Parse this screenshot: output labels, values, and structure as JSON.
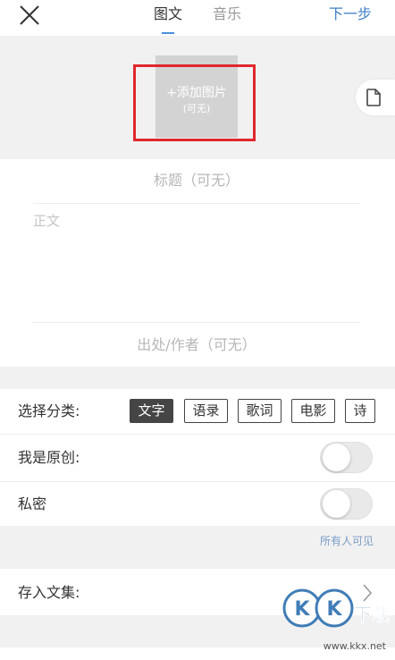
{
  "header": {
    "tabs": [
      {
        "label": "图文",
        "active": true
      },
      {
        "label": "音乐",
        "active": false
      }
    ],
    "next_label": "下一步",
    "accent_color": "#4a90d9"
  },
  "image_upload": {
    "add_label": "+添加图片",
    "optional_label": "(可无)",
    "highlight_color": "#e0282c"
  },
  "form": {
    "title_placeholder": "标题（可无）",
    "body_placeholder": "正文",
    "source_placeholder": "出处/作者（可无）"
  },
  "category": {
    "label": "选择分类:",
    "options": [
      {
        "label": "文字",
        "selected": true
      },
      {
        "label": "语录",
        "selected": false
      },
      {
        "label": "歌词",
        "selected": false
      },
      {
        "label": "电影",
        "selected": false
      },
      {
        "label": "诗",
        "selected": false
      }
    ]
  },
  "original": {
    "label": "我是原创:",
    "on": false
  },
  "private": {
    "label": "私密",
    "on": false
  },
  "visibility_hint": "所有人可见",
  "collection": {
    "label": "存入文集:"
  },
  "watermark": {
    "brand": "KK下载",
    "url": "www.kkx.net"
  },
  "icons": [
    "close-icon",
    "document-icon",
    "chevron-right-icon"
  ]
}
